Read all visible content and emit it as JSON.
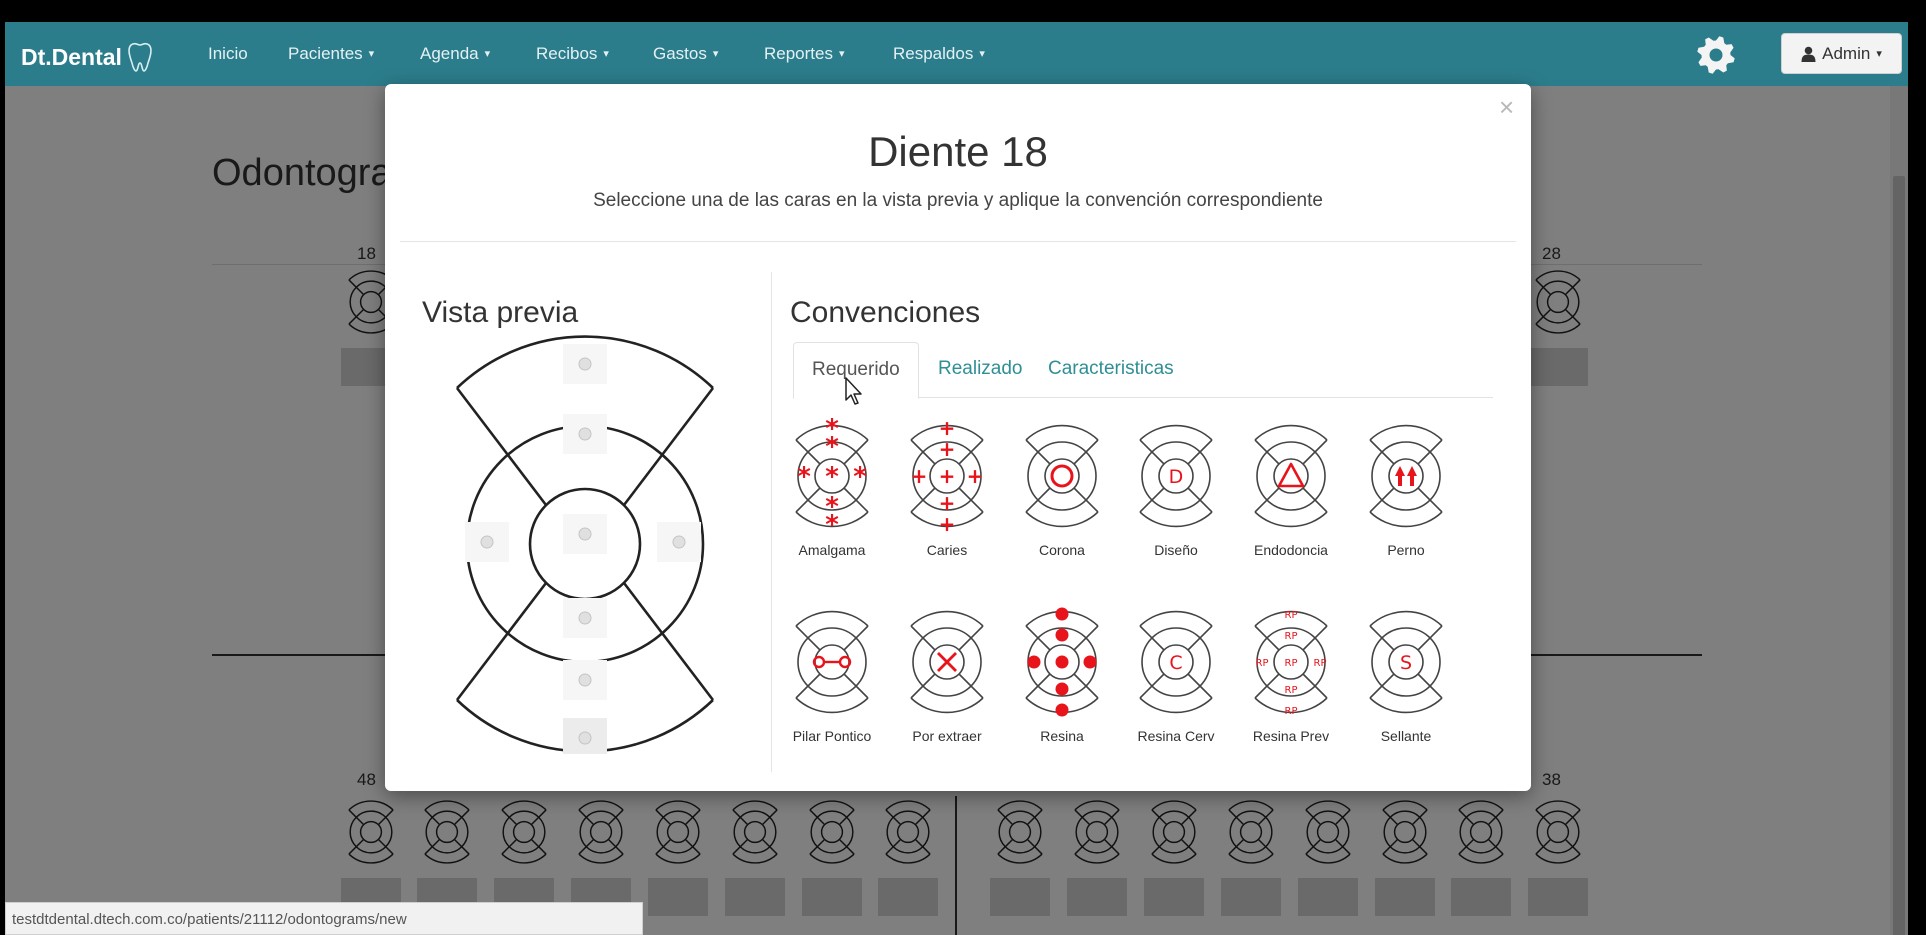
{
  "navbar": {
    "brand": "Dt.Dental",
    "items": [
      {
        "label": "Inicio",
        "has_caret": false
      },
      {
        "label": "Pacientes",
        "has_caret": true
      },
      {
        "label": "Agenda",
        "has_caret": true
      },
      {
        "label": "Recibos",
        "has_caret": true
      },
      {
        "label": "Gastos",
        "has_caret": true
      },
      {
        "label": "Reportes",
        "has_caret": true
      },
      {
        "label": "Respaldos",
        "has_caret": true
      }
    ],
    "settings_icon": "gear-icon",
    "user_menu": "Admin",
    "caret": "▾",
    "color": "#2c7d8c"
  },
  "page": {
    "title": "Odontograma",
    "tooth_numbers": {
      "upper_left": "18",
      "upper_right": "28",
      "lower_left": "48",
      "lower_right": "38"
    }
  },
  "status_bar": {
    "url": "testdtdental.dtech.com.co/patients/21112/odontograms/new"
  },
  "modal": {
    "close": "×",
    "title": "Diente 18",
    "subtitle": "Seleccione una de las caras en la vista previa y aplique la convención correspondiente",
    "preview_heading": "Vista previa",
    "conventions_heading": "Convenciones",
    "tabs": [
      {
        "label": "Requerido",
        "active": true
      },
      {
        "label": "Realizado",
        "active": false
      },
      {
        "label": "Caracteristicas",
        "active": false
      }
    ],
    "conventions": [
      {
        "label": "Amalgama",
        "symbol": "asterisk"
      },
      {
        "label": "Caries",
        "symbol": "plus"
      },
      {
        "label": "Corona",
        "symbol": "circle"
      },
      {
        "label": "Diseño",
        "symbol": "letter",
        "text": "D"
      },
      {
        "label": "Endodoncia",
        "symbol": "triangle"
      },
      {
        "label": "Perno",
        "symbol": "arrows"
      },
      {
        "label": "Pilar Pontico",
        "symbol": "pontic"
      },
      {
        "label": "Por extraer",
        "symbol": "cross"
      },
      {
        "label": "Resina",
        "symbol": "dots"
      },
      {
        "label": "Resina Cerv",
        "symbol": "letter",
        "text": "C"
      },
      {
        "label": "Resina Prev",
        "symbol": "rp",
        "text": "RP"
      },
      {
        "label": "Sellante",
        "symbol": "letter",
        "text": "S"
      }
    ],
    "accent_color": "#e8141b",
    "link_color": "#2f8f96"
  }
}
